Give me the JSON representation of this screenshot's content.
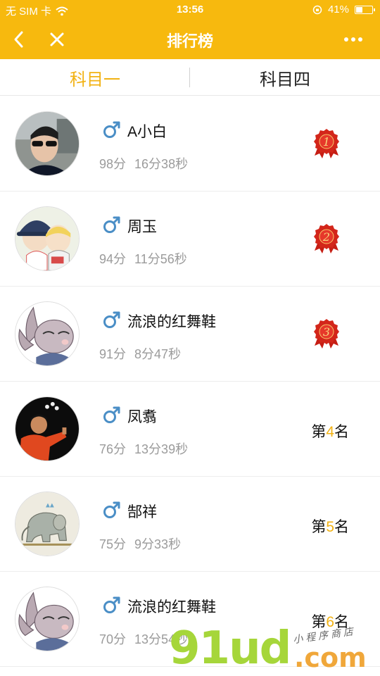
{
  "status_bar": {
    "carrier": "无 SIM 卡",
    "time": "13:56",
    "battery_percent_text": "41%",
    "battery_level": 0.41
  },
  "nav": {
    "title": "排行榜",
    "back_icon": "chevron-left-icon",
    "close_icon": "close-icon",
    "more_icon": "more-dots-icon"
  },
  "tabs": [
    {
      "label": "科目一",
      "active": true
    },
    {
      "label": "科目四",
      "active": false
    }
  ],
  "colors": {
    "brand_yellow": "#f7b90e",
    "tab_active": "#f2b213",
    "gender_male": "#4a8ec6",
    "medal_red": "#d3261a",
    "meta_gray": "#9b9b9b"
  },
  "rankings": [
    {
      "name": "A小白",
      "score": "98分",
      "time": "16分38秒",
      "gender": "male",
      "rank": 1,
      "medal": "1"
    },
    {
      "name": "周玉",
      "score": "94分",
      "time": "11分56秒",
      "gender": "male",
      "rank": 2,
      "medal": "2"
    },
    {
      "name": "流浪的红舞鞋",
      "score": "91分",
      "time": "8分47秒",
      "gender": "male",
      "rank": 3,
      "medal": "3"
    },
    {
      "name": "凤翥",
      "score": "76分",
      "time": "13分39秒",
      "gender": "male",
      "rank": 4,
      "rank_prefix": "第",
      "rank_num": "4",
      "rank_suffix": "名"
    },
    {
      "name": "郜祥",
      "score": "75分",
      "time": "9分33秒",
      "gender": "male",
      "rank": 5,
      "rank_prefix": "第",
      "rank_num": "5",
      "rank_suffix": "名"
    },
    {
      "name": "流浪的红舞鞋",
      "score": "70分",
      "time": "13分54秒",
      "gender": "male",
      "rank": 6,
      "rank_prefix": "第",
      "rank_num": "6",
      "rank_suffix": "名"
    }
  ],
  "watermark": {
    "brand": "91ud",
    "domain": ".com",
    "tagline": "小程序商店"
  }
}
